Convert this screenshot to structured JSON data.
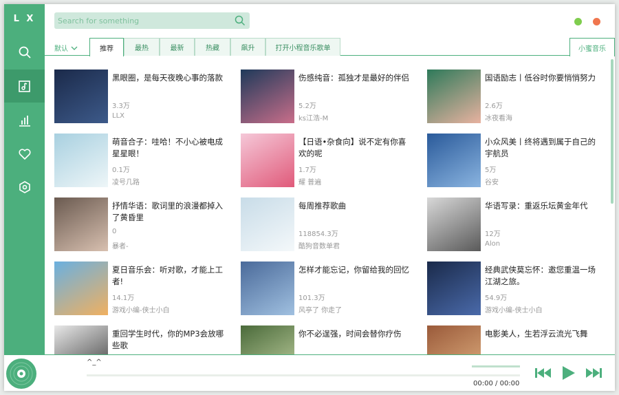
{
  "app": {
    "logo": "L X"
  },
  "colors": {
    "accent": "#4caf7d",
    "accent_dark": "#3d9a6b",
    "minimize": "#7fcd4e",
    "close": "#f0764e"
  },
  "sidebar": {
    "items": [
      {
        "icon": "search-icon"
      },
      {
        "icon": "music-library-icon",
        "active": true
      },
      {
        "icon": "chart-icon"
      },
      {
        "icon": "heart-icon"
      },
      {
        "icon": "settings-icon"
      }
    ]
  },
  "search": {
    "placeholder": "Search for something"
  },
  "tabs": {
    "sort_label": "默认",
    "items": [
      "推荐",
      "最热",
      "最新",
      "热藏",
      "飙升",
      "打开小程音乐歌单"
    ],
    "active": 0,
    "source": "小蜜音乐"
  },
  "playlists": [
    {
      "title": "黑眼圈，是每天夜晚心事的落款",
      "plays": "3.3万",
      "author": "LLX"
    },
    {
      "title": "伤感纯音：孤独才是最好的伴侣",
      "plays": "5.2万",
      "author": "ks江浩-M"
    },
    {
      "title": "国语励志丨低谷时你要悄悄努力",
      "plays": "2.6万",
      "author": "冰夜看海"
    },
    {
      "title": "萌音合子：哇哈！不小心被电成星星眼！",
      "plays": "0.1万",
      "author": "凌号几路"
    },
    {
      "title": "【日语•杂食向】说不定有你喜欢的呢",
      "plays": "1.7万",
      "author": "耀 普遍"
    },
    {
      "title": "小众风美丨终将遇到属于自己的宇航员",
      "plays": "5万",
      "author": "谷安"
    },
    {
      "title": "抒情华语：歌词里的浪漫都掉入了黄昏里",
      "plays": "0",
      "author": "暴者-"
    },
    {
      "title": "每周推荐歌曲",
      "plays": "118854.3万",
      "author": "酷狗音数单君"
    },
    {
      "title": "华语写录：重返乐坛黄金年代",
      "plays": "12万",
      "author": "Alon"
    },
    {
      "title": "夏日音乐会：听对歌，才能上工者!",
      "plays": "14.1万",
      "author": "游戏小编-侠士小白"
    },
    {
      "title": "怎样才能忘记，你留给我的回忆",
      "plays": "101.3万",
      "author": "风亭了 你走了"
    },
    {
      "title": "经典武侠莫忘怀：邀您重温一场江湖之旅。",
      "plays": "54.9万",
      "author": "游戏小编-侠士小白"
    },
    {
      "title": "重回学生时代，你的MP3会放哪些歌",
      "plays": "",
      "author": ""
    },
    {
      "title": "你不必逞强，时间会替你疗伤",
      "plays": "",
      "author": ""
    },
    {
      "title": "电影美人，生若浮云流光飞舞",
      "plays": "",
      "author": ""
    }
  ],
  "player": {
    "song": "^_^",
    "current_time": "00:00",
    "separator": "/",
    "total_time": "00:00",
    "progress": 0
  }
}
